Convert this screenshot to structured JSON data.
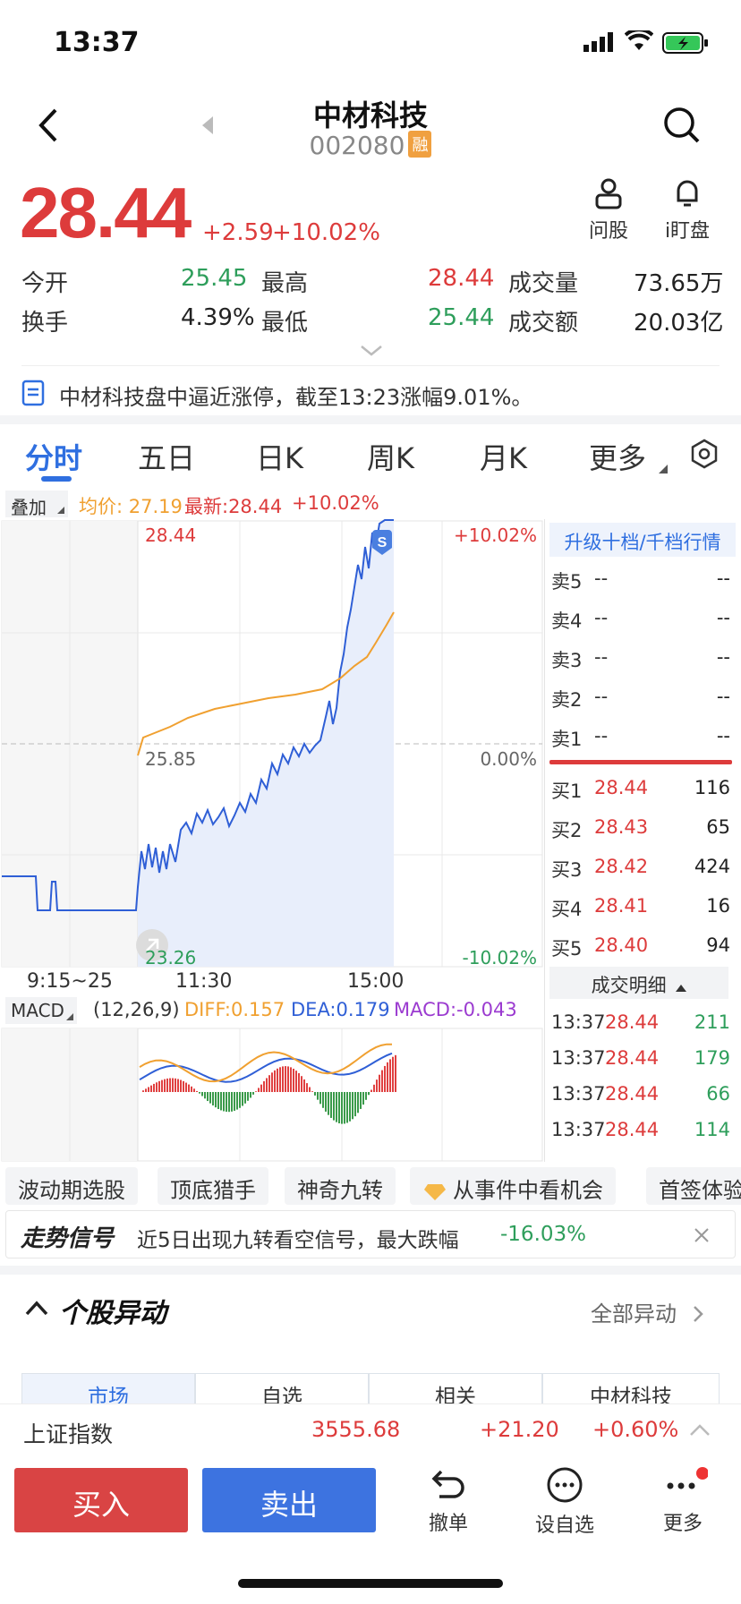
{
  "status_bar": {
    "time": "13:37"
  },
  "header": {
    "title": "中材科技",
    "code": "002080",
    "badge": "融"
  },
  "actions": {
    "ask_label": "问股",
    "watch_label": "i盯盘"
  },
  "quote": {
    "price": "28.44",
    "change": "+2.59",
    "change_pct": "+10.02%",
    "open_label": "今开",
    "open": "25.45",
    "high_label": "最高",
    "high": "28.44",
    "volume_label": "成交量",
    "volume": "73.65万",
    "turnover_label": "换手",
    "turnover": "4.39%",
    "low_label": "最低",
    "low": "25.44",
    "amount_label": "成交额",
    "amount": "20.03亿"
  },
  "notice": "中材科技盘中逼近涨停，截至13:23涨幅9.01%。",
  "tabs": [
    "分时",
    "五日",
    "日K",
    "周K",
    "月K",
    "更多"
  ],
  "chart": {
    "overlay_label": "叠加",
    "avg_label": "均价: 27.19",
    "latest_label": "最新:28.44",
    "latest_pct": "+10.02%",
    "y_top": "28.44",
    "y_mid": "25.85",
    "y_bot": "23.26",
    "pct_top": "+10.02%",
    "pct_mid": "0.00%",
    "pct_bot": "-10.02%",
    "x_labels": [
      "9:15~25",
      "11:30",
      "15:00"
    ],
    "marker": "S",
    "colors": {
      "price_line": "#2f5fd6",
      "avg_line": "#f0a030",
      "fill": "#e8eefb"
    }
  },
  "macd": {
    "label": "MACD",
    "params": "(12,26,9)",
    "diff": "DIFF:0.157",
    "dea": "DEA:0.179",
    "macd": "MACD:-0.043"
  },
  "order_book": {
    "upgrade_label": "升级十档/千档行情",
    "sells": [
      {
        "label": "卖5",
        "price": "--",
        "vol": "--"
      },
      {
        "label": "卖4",
        "price": "--",
        "vol": "--"
      },
      {
        "label": "卖3",
        "price": "--",
        "vol": "--"
      },
      {
        "label": "卖2",
        "price": "--",
        "vol": "--"
      },
      {
        "label": "卖1",
        "price": "--",
        "vol": "--"
      }
    ],
    "buys": [
      {
        "label": "买1",
        "price": "28.44",
        "vol": "116"
      },
      {
        "label": "买2",
        "price": "28.43",
        "vol": "65"
      },
      {
        "label": "买3",
        "price": "28.42",
        "vol": "424"
      },
      {
        "label": "买4",
        "price": "28.41",
        "vol": "16"
      },
      {
        "label": "买5",
        "price": "28.40",
        "vol": "94"
      }
    ],
    "detail_label": "成交明细",
    "ticks": [
      {
        "time": "13:37",
        "price": "28.44",
        "vol": "211"
      },
      {
        "time": "13:37",
        "price": "28.44",
        "vol": "179"
      },
      {
        "time": "13:37",
        "price": "28.44",
        "vol": "66"
      },
      {
        "time": "13:37",
        "price": "28.44",
        "vol": "114"
      }
    ]
  },
  "pills": [
    "波动期选股",
    "顶底猎手",
    "神奇九转",
    "从事件中看机会",
    "首签体验"
  ],
  "signal": {
    "title": "走势信号",
    "text": "近5日出现九转看空信号，最大跌幅",
    "value": "-16.03%"
  },
  "movers": {
    "title": "个股异动",
    "all_label": "全部异动",
    "segments": [
      "市场",
      "自选",
      "相关",
      "中材科技"
    ]
  },
  "index_bar": {
    "name": "上证指数",
    "value": "3555.68",
    "change": "+21.20",
    "pct": "+0.60%"
  },
  "bottom": {
    "buy": "买入",
    "sell": "卖出",
    "cancel": "撤单",
    "watchlist": "设自选",
    "more": "更多"
  }
}
